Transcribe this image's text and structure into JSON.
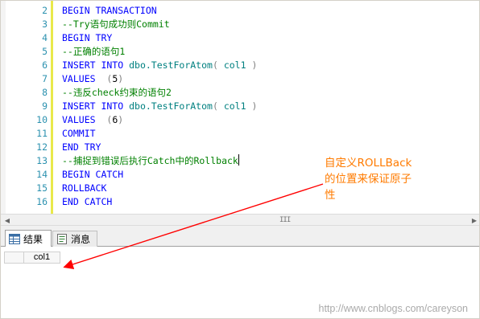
{
  "editor": {
    "lines": [
      {
        "num": "2",
        "parts": [
          {
            "text": "BEGIN TRANSACTION",
            "cls": ""
          }
        ],
        "comment": false
      },
      {
        "num": "3",
        "parts": [
          {
            "text": "--Try语句成功则Commit",
            "cls": ""
          }
        ],
        "comment": true
      },
      {
        "num": "4",
        "parts": [
          {
            "text": "BEGIN TRY",
            "cls": ""
          }
        ],
        "comment": false
      },
      {
        "num": "5",
        "parts": [
          {
            "text": "--正确的语句1",
            "cls": ""
          }
        ],
        "comment": true
      },
      {
        "num": "6",
        "parts": [
          {
            "text": "INSERT INTO ",
            "cls": ""
          },
          {
            "text": "dbo.TestForAtom",
            "cls": "t-obj"
          },
          {
            "text": "( ",
            "cls": "t-sep"
          },
          {
            "text": "col1",
            "cls": "t-obj"
          },
          {
            "text": " )",
            "cls": "t-sep"
          }
        ],
        "comment": false
      },
      {
        "num": "7",
        "parts": [
          {
            "text": "VALUES  ",
            "cls": ""
          },
          {
            "text": "(",
            "cls": "t-sep"
          },
          {
            "text": "5",
            "cls": "t-num"
          },
          {
            "text": ")",
            "cls": "t-sep"
          }
        ],
        "comment": false
      },
      {
        "num": "8",
        "parts": [
          {
            "text": "--违反check约束的语句2",
            "cls": ""
          }
        ],
        "comment": true
      },
      {
        "num": "9",
        "parts": [
          {
            "text": "INSERT INTO ",
            "cls": ""
          },
          {
            "text": "dbo.TestForAtom",
            "cls": "t-obj"
          },
          {
            "text": "( ",
            "cls": "t-sep"
          },
          {
            "text": "col1",
            "cls": "t-obj"
          },
          {
            "text": " )",
            "cls": "t-sep"
          }
        ],
        "comment": false
      },
      {
        "num": "10",
        "parts": [
          {
            "text": "VALUES  ",
            "cls": ""
          },
          {
            "text": "(",
            "cls": "t-sep"
          },
          {
            "text": "6",
            "cls": "t-num"
          },
          {
            "text": ")",
            "cls": "t-sep"
          }
        ],
        "comment": false
      },
      {
        "num": "11",
        "parts": [
          {
            "text": "COMMIT",
            "cls": ""
          }
        ],
        "comment": false
      },
      {
        "num": "12",
        "parts": [
          {
            "text": "END TRY",
            "cls": ""
          }
        ],
        "comment": false
      },
      {
        "num": "13",
        "parts": [
          {
            "text": "--捕捉到错误后执行Catch中的Rollback",
            "cls": ""
          }
        ],
        "comment": true,
        "caret": true
      },
      {
        "num": "14",
        "parts": [
          {
            "text": "BEGIN CATCH",
            "cls": ""
          }
        ],
        "comment": false
      },
      {
        "num": "15",
        "parts": [
          {
            "text": "ROLLBACK",
            "cls": ""
          }
        ],
        "comment": false
      },
      {
        "num": "16",
        "parts": [
          {
            "text": "END CATCH",
            "cls": ""
          }
        ],
        "comment": false
      }
    ]
  },
  "annotation": {
    "line1": "自定义ROLLBack",
    "line2": "的位置来保证原子",
    "line3": "性",
    "color": "#ff7b00",
    "arrow_color": "#ff0000"
  },
  "scrollbar": {
    "left_icon": "scroll-left-arrow-icon",
    "grip": "III",
    "right_icon": "scroll-right-arrow-icon"
  },
  "tabs": {
    "results_label": "结果",
    "results_icon": "grid-icon",
    "messages_label": "消息",
    "messages_icon": "message-icon"
  },
  "grid": {
    "columns": [
      "col1"
    ]
  },
  "watermark": "http://www.cnblogs.com/careyson",
  "colors": {
    "keyword": "#0000ff",
    "comment": "#008000",
    "identifier": "#008080",
    "line_number": "#2b91af",
    "change_bar": "#e9e94a"
  }
}
